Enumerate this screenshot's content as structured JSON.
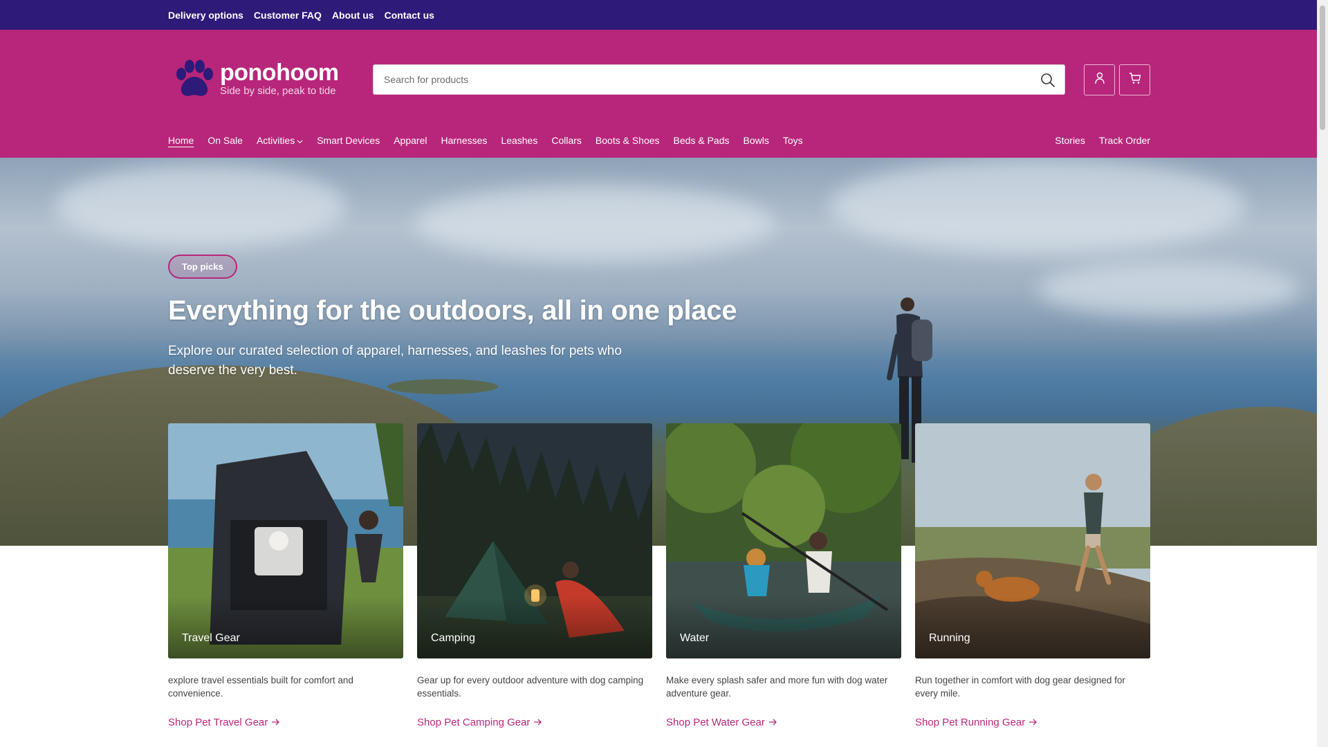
{
  "utility": {
    "links": [
      "Delivery options",
      "Customer FAQ",
      "About us",
      "Contact us"
    ]
  },
  "brand": {
    "name": "ponohoom",
    "tagline": "Side by side, peak to tide",
    "color": "#b7267a",
    "topbar_color": "#2e1a78"
  },
  "search": {
    "placeholder": "Search for products",
    "icon": "search-icon"
  },
  "header_icons": [
    "account-icon",
    "cart-icon"
  ],
  "nav": {
    "items": [
      "Home",
      "On Sale",
      "Activities",
      "Smart Devices",
      "Apparel",
      "Harnesses",
      "Leashes",
      "Collars",
      "Boots & Shoes",
      "Beds & Pads",
      "Bowls",
      "Toys"
    ],
    "active": "Home",
    "right": [
      "Stories",
      "Track Order"
    ]
  },
  "hero": {
    "badge": "Top picks",
    "title": "Everything for the outdoors, all in one place",
    "subtitle": "Explore our curated selection of apparel, harnesses, and leashes for pets who deserve the very best."
  },
  "categories": [
    {
      "label": "Travel Gear",
      "description": "explore travel essentials built for comfort and convenience.",
      "link": "Shop Pet Travel Gear"
    },
    {
      "label": "Camping",
      "description": "Gear up for every outdoor adventure with dog camping essentials.",
      "link": "Shop Pet Camping Gear"
    },
    {
      "label": "Water",
      "description": "Make every splash safer and more fun with dog water adventure gear.",
      "link": "Shop Pet Water Gear"
    },
    {
      "label": "Running",
      "description": "Run together in comfort with dog gear designed for every mile.",
      "link": "Shop Pet Running Gear"
    }
  ]
}
